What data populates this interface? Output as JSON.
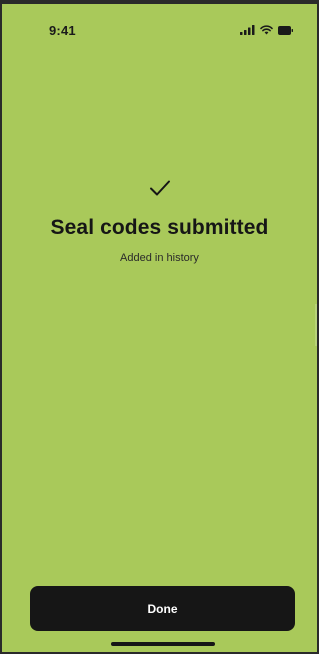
{
  "status_bar": {
    "time": "9:41",
    "icons": [
      "cellular-signal-icon",
      "wifi-icon",
      "battery-icon"
    ]
  },
  "confirmation": {
    "icon": "checkmark-icon",
    "title": "Seal codes submitted",
    "subtitle": "Added in history"
  },
  "actions": {
    "done_label": "Done"
  },
  "colors": {
    "background": "#a9c95a",
    "button": "#161616",
    "button_text": "#ffffff",
    "text": "#161616"
  }
}
